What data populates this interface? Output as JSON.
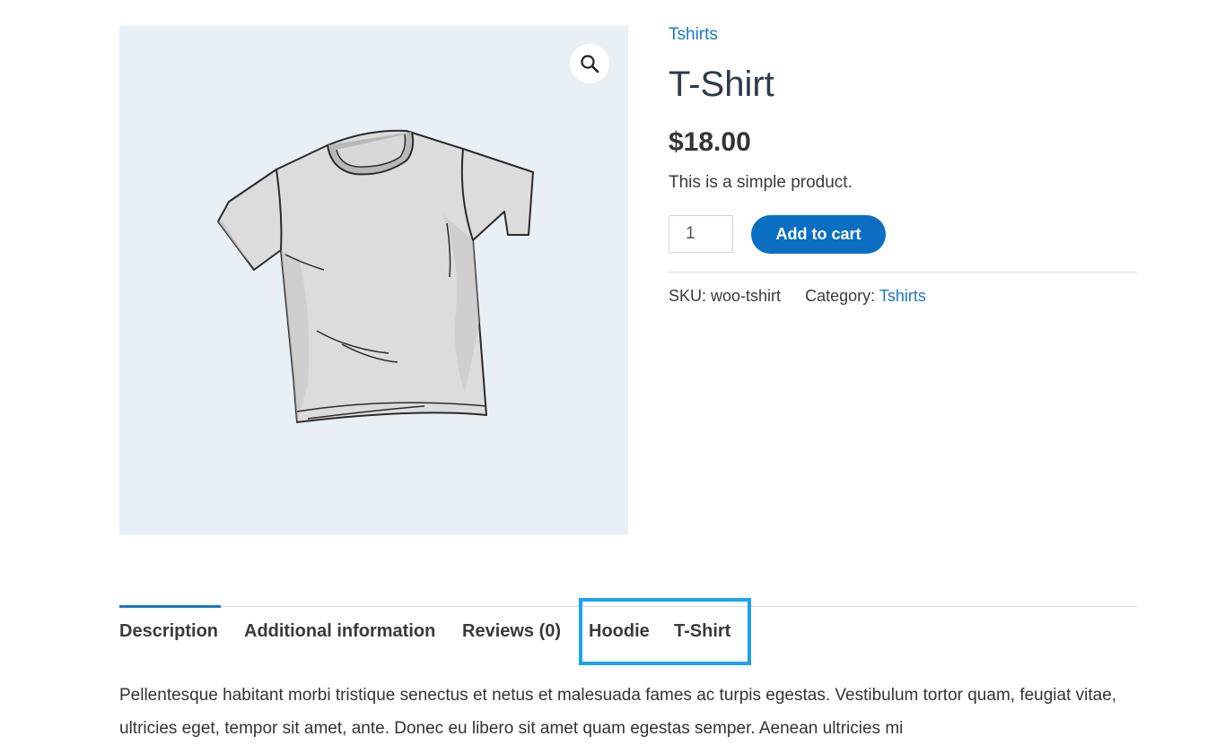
{
  "breadcrumb_category": "Tshirts",
  "product": {
    "title": "T-Shirt",
    "price": "$18.00",
    "short_description": "This is a simple product.",
    "quantity": "1",
    "add_to_cart_label": "Add to cart"
  },
  "meta": {
    "sku_label": "SKU:",
    "sku_value": "woo-tshirt",
    "category_label": "Category:",
    "category_value": "Tshirts"
  },
  "tabs": [
    {
      "label": "Description",
      "active": true
    },
    {
      "label": "Additional information",
      "active": false
    },
    {
      "label": "Reviews (0)",
      "active": false
    },
    {
      "label": "Hoodie",
      "active": false
    },
    {
      "label": "T-Shirt",
      "active": false
    }
  ],
  "description": "Pellentesque habitant morbi tristique senectus et netus et malesuada fames ac turpis egestas. Vestibulum tortor quam, feugiat vitae, ultricies eget, tempor sit amet, ante. Donec eu libero sit amet quam egestas semper. Aenean ultricies mi",
  "icons": {
    "zoom": "magnifier-icon"
  },
  "colors": {
    "accent": "#0a6fc2",
    "link": "#1a79c2",
    "highlight": "#1aa3f0",
    "gallery_bg": "#e8eff5"
  }
}
